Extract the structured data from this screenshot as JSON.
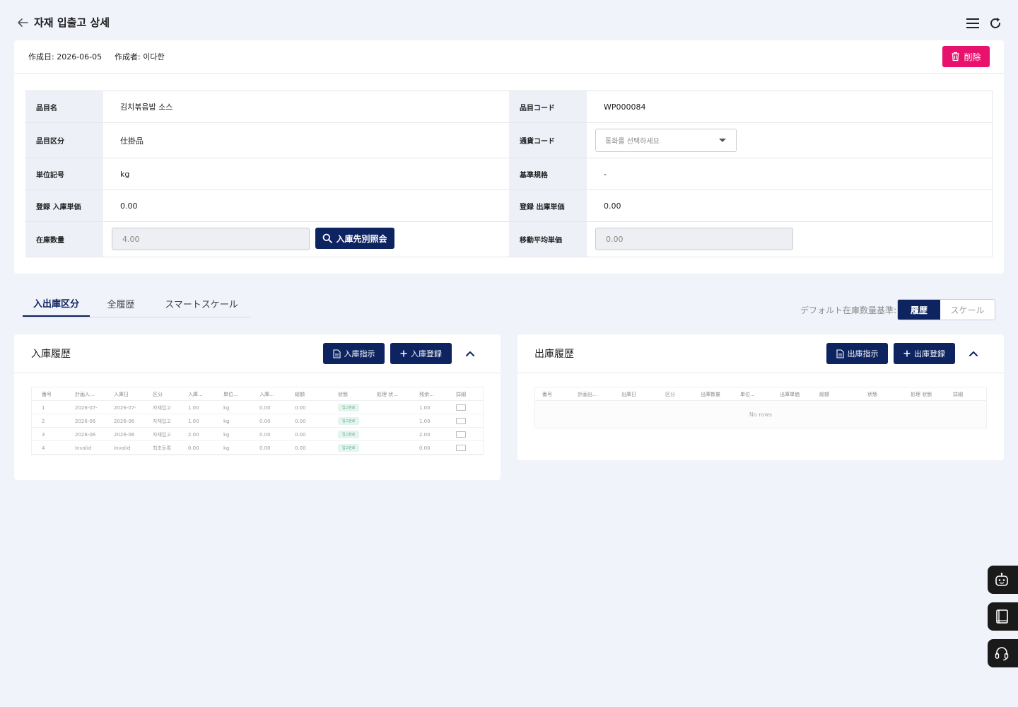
{
  "header": {
    "title": "자재 입출고 상세"
  },
  "meta": {
    "date_label": "作成日:",
    "date_value": "2026-06-05",
    "author_label": "作成者:",
    "author_value": "이다한",
    "delete_label": "削除"
  },
  "details": {
    "item_name_label": "品目名",
    "item_name": "김치볶음밥 소스",
    "item_code_label": "品目コード",
    "item_code": "WP000084",
    "item_category_label": "品目区分",
    "item_category": "仕掛品",
    "currency_label": "通貨コード",
    "currency_placeholder": "통화를 선택하세요",
    "unit_label": "単位記号",
    "unit": "kg",
    "standard_label": "基準規格",
    "standard": "-",
    "in_price_label": "登録 入庫単価",
    "in_price": "0.00",
    "out_price_label": "登録 出庫単価",
    "out_price": "0.00",
    "stock_qty_label": "在庫数量",
    "stock_qty": "4.00",
    "lookup_label": "入庫先別照会",
    "avg_price_label": "移動平均単価",
    "avg_price": "0.00"
  },
  "tabs": [
    "入出庫区分",
    "全履歴",
    "スマートスケール"
  ],
  "basis": {
    "label": "デフォルト在庫数量基準:",
    "options": [
      "履歴",
      "スケール"
    ]
  },
  "inbound": {
    "title": "入庫履歴",
    "instruct_label": "入庫指示",
    "register_label": "入庫登録",
    "columns": [
      "番号",
      "計画入…",
      "入庫日",
      "区分",
      "入庫…",
      "単位…",
      "入庫…",
      "総額",
      "状態",
      "処理 状…",
      "残余…",
      "詳細"
    ],
    "rows": [
      [
        "1",
        "2026-07-",
        "2026-07-",
        "자재입고",
        "1.00",
        "kg",
        "0.00",
        "0.00",
        "입고완료",
        "",
        "1.00"
      ],
      [
        "2",
        "2026-06",
        "2026-06",
        "자재입고",
        "1.00",
        "kg",
        "0.00",
        "0.00",
        "입고완료",
        "",
        "1.00"
      ],
      [
        "3",
        "2026-06",
        "2026-06",
        "자재입고",
        "2.00",
        "kg",
        "0.00",
        "0.00",
        "입고완료",
        "",
        "2.00"
      ],
      [
        "4",
        "Invalid",
        "Invalid",
        "최초등록",
        "0.00",
        "kg",
        "0.00",
        "0.00",
        "입고완료",
        "",
        "0.00"
      ]
    ]
  },
  "outbound": {
    "title": "出庫履歴",
    "instruct_label": "出庫指示",
    "register_label": "出庫登録",
    "columns": [
      "番号",
      "計画出…",
      "出庫日",
      "区分",
      "出庫数量",
      "単位…",
      "出庫単価",
      "総額",
      "状態",
      "処理 状態",
      "詳細"
    ],
    "empty": "No rows"
  },
  "icons": {
    "back": "arrow-left-icon",
    "menu": "hamburger-menu-icon",
    "refresh": "refresh-icon",
    "delete": "trash-icon",
    "search": "search-icon",
    "document": "document-icon",
    "plus": "plus-icon",
    "collapse": "chevron-up-icon",
    "chatbot": "robot-icon",
    "manual": "book-icon",
    "support": "headset-icon"
  },
  "colors": {
    "primary": "#0e2460",
    "danger": "#e8116e",
    "background": "#f1f3fa",
    "label_bg": "#eef0f8"
  }
}
